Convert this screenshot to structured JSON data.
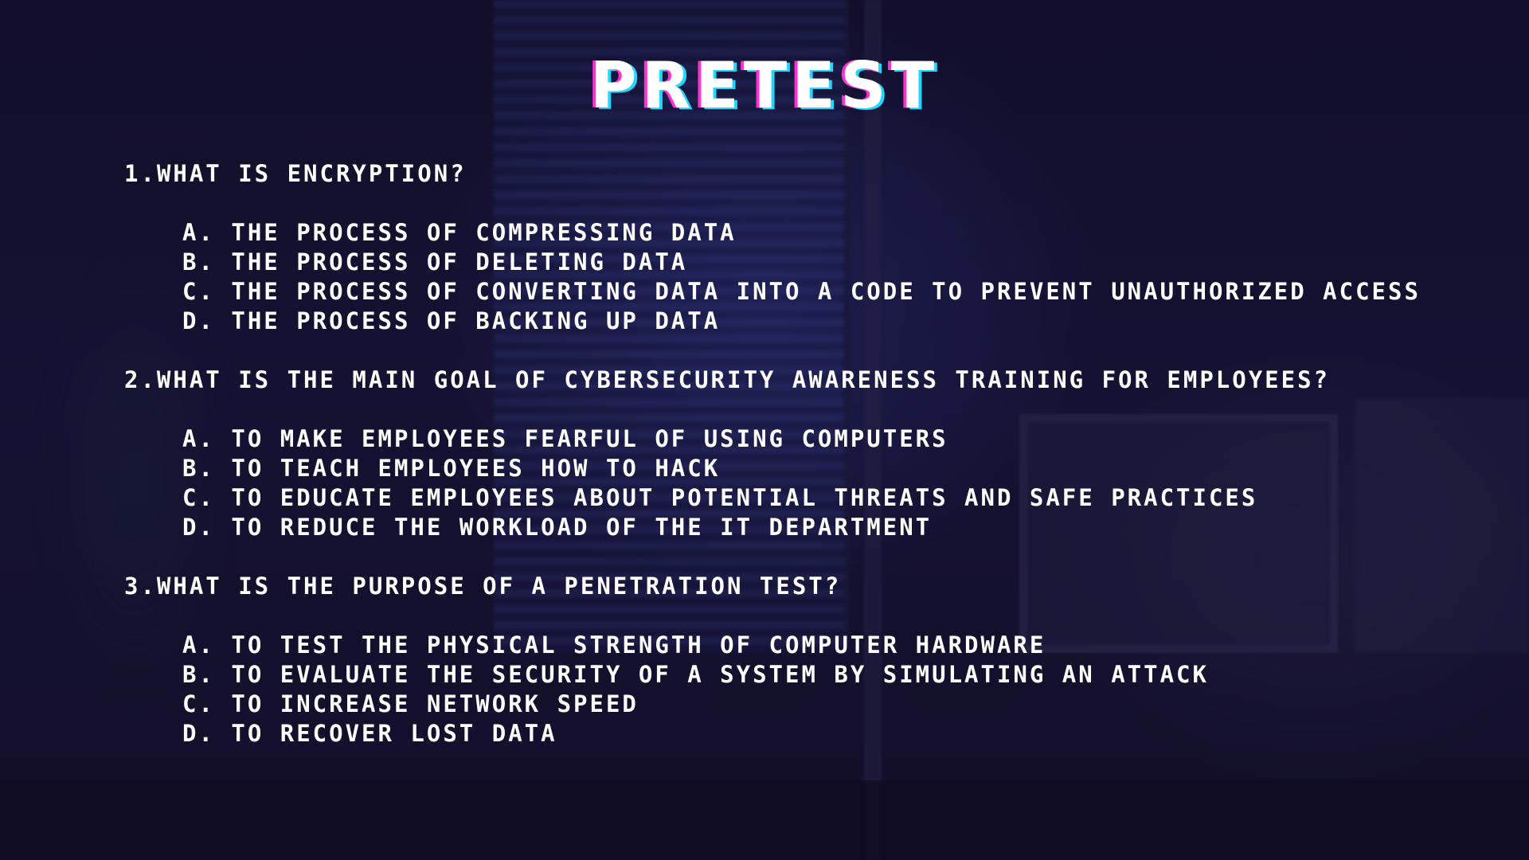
{
  "title": "PRETEST",
  "questions": [
    {
      "text": "1.WHAT IS ENCRYPTION?",
      "options": [
        "A. THE PROCESS OF COMPRESSING DATA",
        "B. THE PROCESS OF DELETING DATA",
        "C. THE PROCESS OF CONVERTING DATA INTO A CODE TO PREVENT UNAUTHORIZED ACCESS",
        "D. THE PROCESS OF BACKING UP DATA"
      ]
    },
    {
      "text": "2.WHAT IS THE MAIN GOAL OF CYBERSECURITY AWARENESS TRAINING FOR EMPLOYEES?",
      "options": [
        "A. TO MAKE EMPLOYEES FEARFUL OF USING COMPUTERS",
        "B. TO TEACH EMPLOYEES HOW TO HACK",
        "C. TO EDUCATE EMPLOYEES ABOUT POTENTIAL THREATS AND SAFE PRACTICES",
        "D. TO REDUCE THE WORKLOAD OF THE IT DEPARTMENT"
      ]
    },
    {
      "text": "3.WHAT IS THE PURPOSE OF A PENETRATION TEST?",
      "options": [
        "A. TO TEST THE PHYSICAL STRENGTH OF COMPUTER HARDWARE",
        "B. TO EVALUATE THE SECURITY OF A SYSTEM BY SIMULATING AN ATTACK",
        "C. TO INCREASE NETWORK SPEED",
        "D. TO RECOVER LOST DATA"
      ]
    }
  ],
  "colors": {
    "background": "#14102c",
    "text": "#ffffff",
    "title_shadow_magenta": "#ff2fd0",
    "title_shadow_cyan": "#20d8ff"
  }
}
